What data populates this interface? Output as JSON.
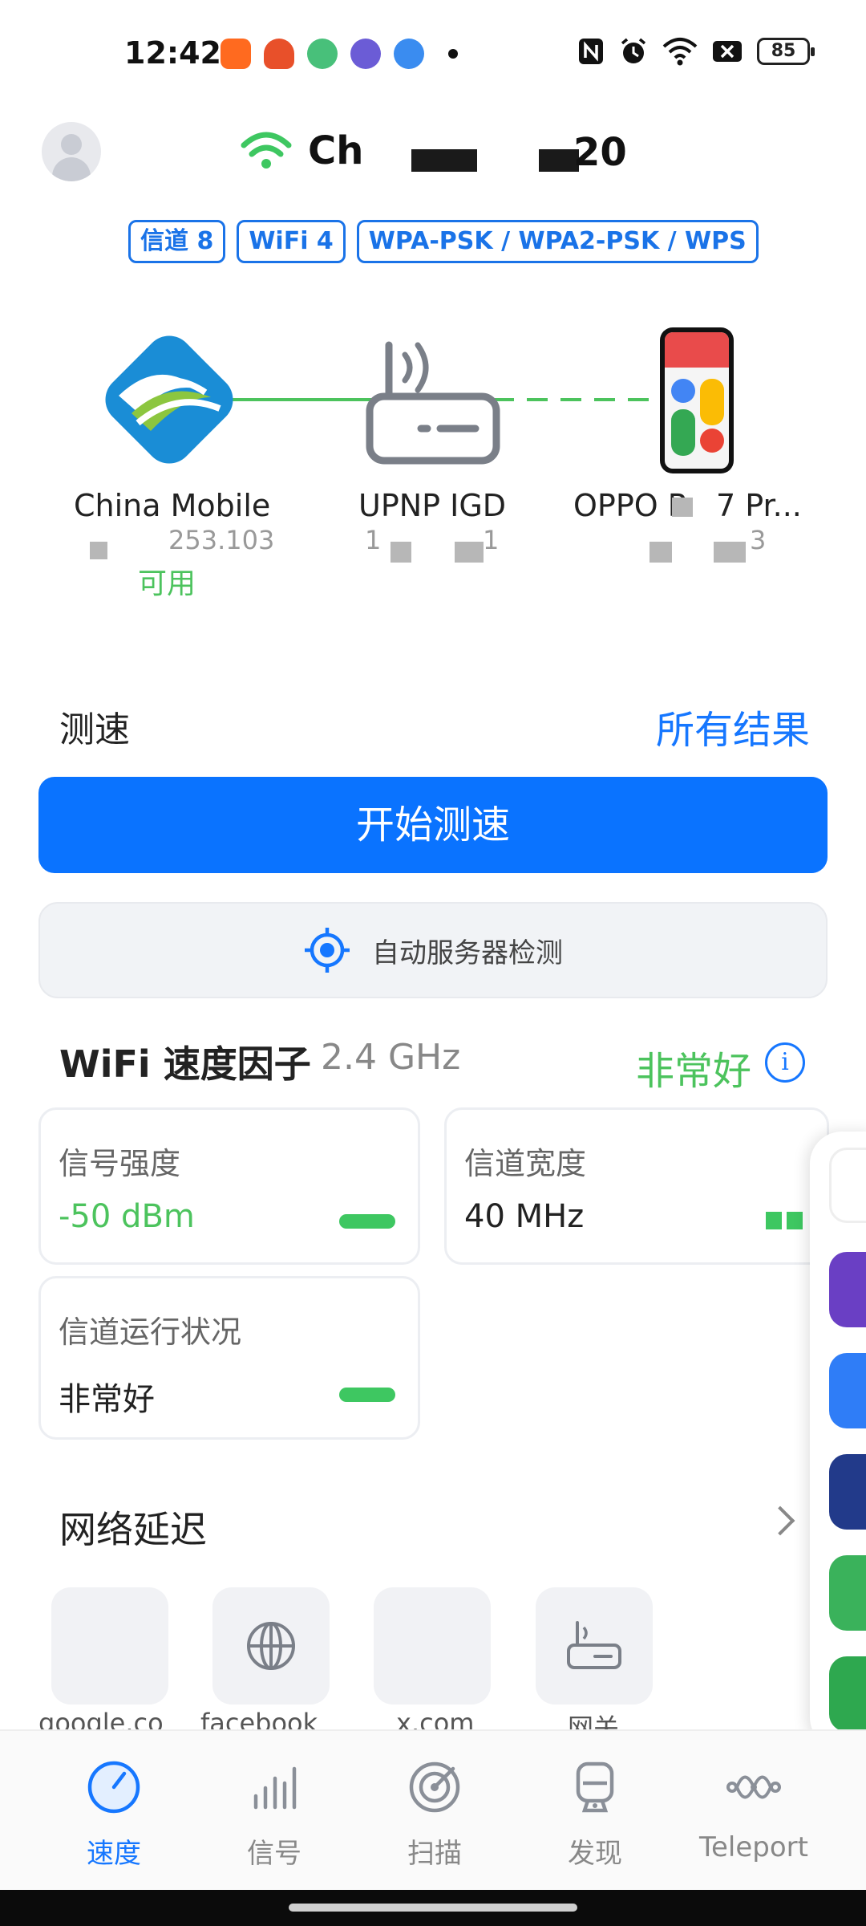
{
  "status_bar": {
    "time": "12:42",
    "battery": "85",
    "notification_icons": [
      "kuaishou-icon",
      "app-icon",
      "app-icon",
      "tieba-icon",
      "app-icon",
      "more-dot"
    ],
    "system_icons": [
      "nfc-icon",
      "alarm-icon",
      "wifi-icon",
      "close-box-icon",
      "battery-icon"
    ]
  },
  "header": {
    "ssid": "Ch",
    "ssid_suffix": "20",
    "tags": [
      "信道 8",
      "WiFi 4",
      "WPA-PSK / WPA2-PSK / WPS"
    ]
  },
  "topology": {
    "nodes": [
      {
        "label": "China Mobile",
        "ip": "253.103",
        "status": "可用"
      },
      {
        "label": "UPNP IGD",
        "ip": "1",
        "ip_tail": "1"
      },
      {
        "label": "OPPO R",
        "label_tail": "7 Pr...",
        "ip": "3"
      }
    ]
  },
  "speed_test": {
    "title": "测速",
    "all_results": "所有结果",
    "start_button": "开始测速",
    "server_button": "自动服务器检测"
  },
  "wifi_factors": {
    "title": "WiFi 速度因子",
    "band": "2.4 GHz",
    "rating": "非常好",
    "info": "i",
    "cards": [
      {
        "title": "信号强度",
        "value": "-50 dBm"
      },
      {
        "title": "信道宽度",
        "value": "40 MHz"
      },
      {
        "title": "信道运行状况",
        "value": "非常好"
      }
    ]
  },
  "latency": {
    "title": "网络延迟",
    "items": [
      {
        "label": "google.co"
      },
      {
        "label": "facebook"
      },
      {
        "label": "x.com"
      },
      {
        "label": "网关"
      }
    ]
  },
  "bottom_nav": {
    "items": [
      {
        "label": "速度"
      },
      {
        "label": "信号"
      },
      {
        "label": "扫描"
      },
      {
        "label": "发现"
      },
      {
        "label": "Teleport"
      }
    ]
  },
  "colors": {
    "accent": "#0a73ff",
    "good": "#4cc35d"
  }
}
